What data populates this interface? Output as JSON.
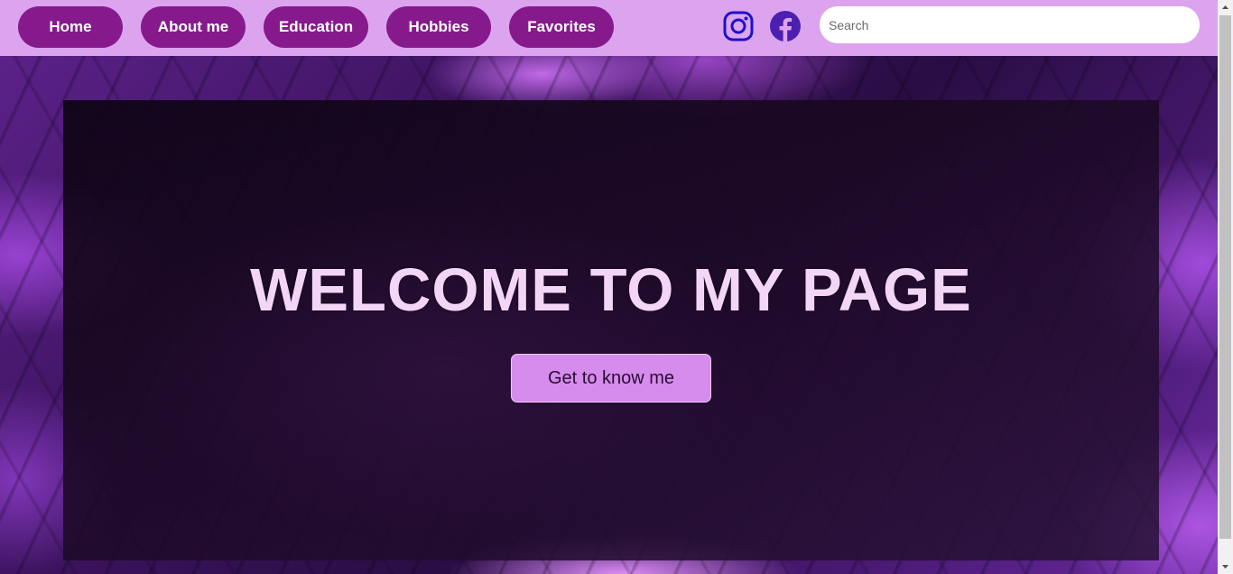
{
  "nav": {
    "items": [
      {
        "label": "Home"
      },
      {
        "label": "About me"
      },
      {
        "label": "Education"
      },
      {
        "label": "Hobbies"
      },
      {
        "label": "Favorites"
      }
    ],
    "social": {
      "instagram_icon": "instagram-icon",
      "facebook_icon": "facebook-icon"
    },
    "search": {
      "placeholder": "Search",
      "value": ""
    }
  },
  "hero": {
    "title": "WELCOME TO MY PAGE",
    "cta_label": "Get to know me"
  },
  "colors": {
    "navbar_bg": "#dca4ee",
    "nav_button_bg": "#861a8c",
    "icon_color": "#1f10c8",
    "cta_bg": "#d58cec",
    "title_color": "#f3d6f7"
  }
}
